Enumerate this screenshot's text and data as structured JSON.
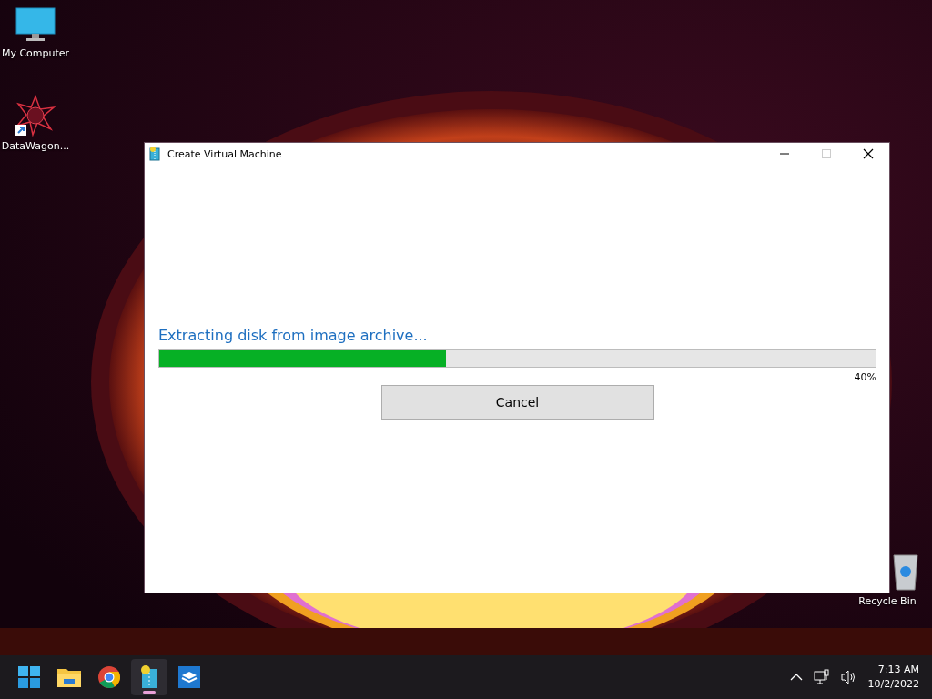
{
  "desktop_icons": [
    {
      "kind": "computer",
      "label": "My Computer"
    },
    {
      "kind": "shortcut",
      "label": "DataWagon..."
    },
    {
      "kind": "bin",
      "label": "Recycle Bin"
    }
  ],
  "window": {
    "title": "Create Virtual Machine",
    "message": "Extracting disk from image archive...",
    "progress": {
      "level": 0.4,
      "reading": "40%"
    },
    "button": "Cancel"
  },
  "taskbar": {
    "apps": [
      {
        "kind": "start",
        "selected": false
      },
      {
        "kind": "folder",
        "selected": false
      },
      {
        "kind": "browser",
        "selected": false
      },
      {
        "kind": "archive",
        "selected": true
      },
      {
        "kind": "box",
        "selected": false
      }
    ],
    "time": "7:13 AM",
    "date": "10/2/2022"
  }
}
